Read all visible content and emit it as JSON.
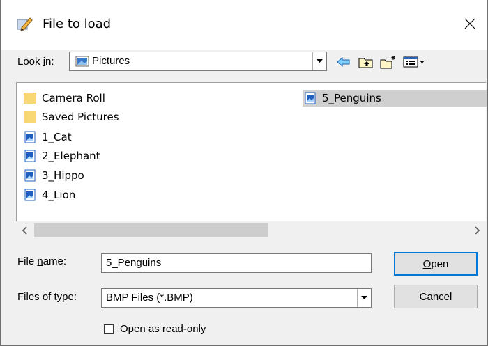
{
  "window": {
    "title": "File to load",
    "close_glyph": "✕"
  },
  "look_in": {
    "label_pre": "Look ",
    "label_mnemonic": "i",
    "label_post": "n:",
    "value": "Pictures"
  },
  "toolbar": {
    "icons": [
      "back-arrow-icon",
      "up-folder-icon",
      "new-folder-icon",
      "view-menu-icon"
    ]
  },
  "files": [
    {
      "name": "Camera Roll",
      "kind": "folder"
    },
    {
      "name": "Saved Pictures",
      "kind": "folder"
    },
    {
      "name": "1_Cat",
      "kind": "image"
    },
    {
      "name": "2_Elephant",
      "kind": "image"
    },
    {
      "name": "3_Hippo",
      "kind": "image"
    },
    {
      "name": "4_Lion",
      "kind": "image"
    },
    {
      "name": "5_Penguins",
      "kind": "image",
      "selected": true
    }
  ],
  "file_name": {
    "label_pre": "File ",
    "label_mnemonic": "n",
    "label_post": "ame:",
    "value": "5_Penguins"
  },
  "file_type": {
    "label": "Files of type:",
    "value": "BMP Files (*.BMP)"
  },
  "buttons": {
    "open_mnemonic": "O",
    "open_rest": "pen",
    "cancel": "Cancel"
  },
  "read_only": {
    "label_pre": "Open as ",
    "label_mnemonic": "r",
    "label_post": "ead-only",
    "checked": false
  },
  "colors": {
    "folder": "#f8d775",
    "image_icon": "#1f5fbf",
    "focus_border": "#0078d7",
    "selection": "#cfcfcf"
  }
}
